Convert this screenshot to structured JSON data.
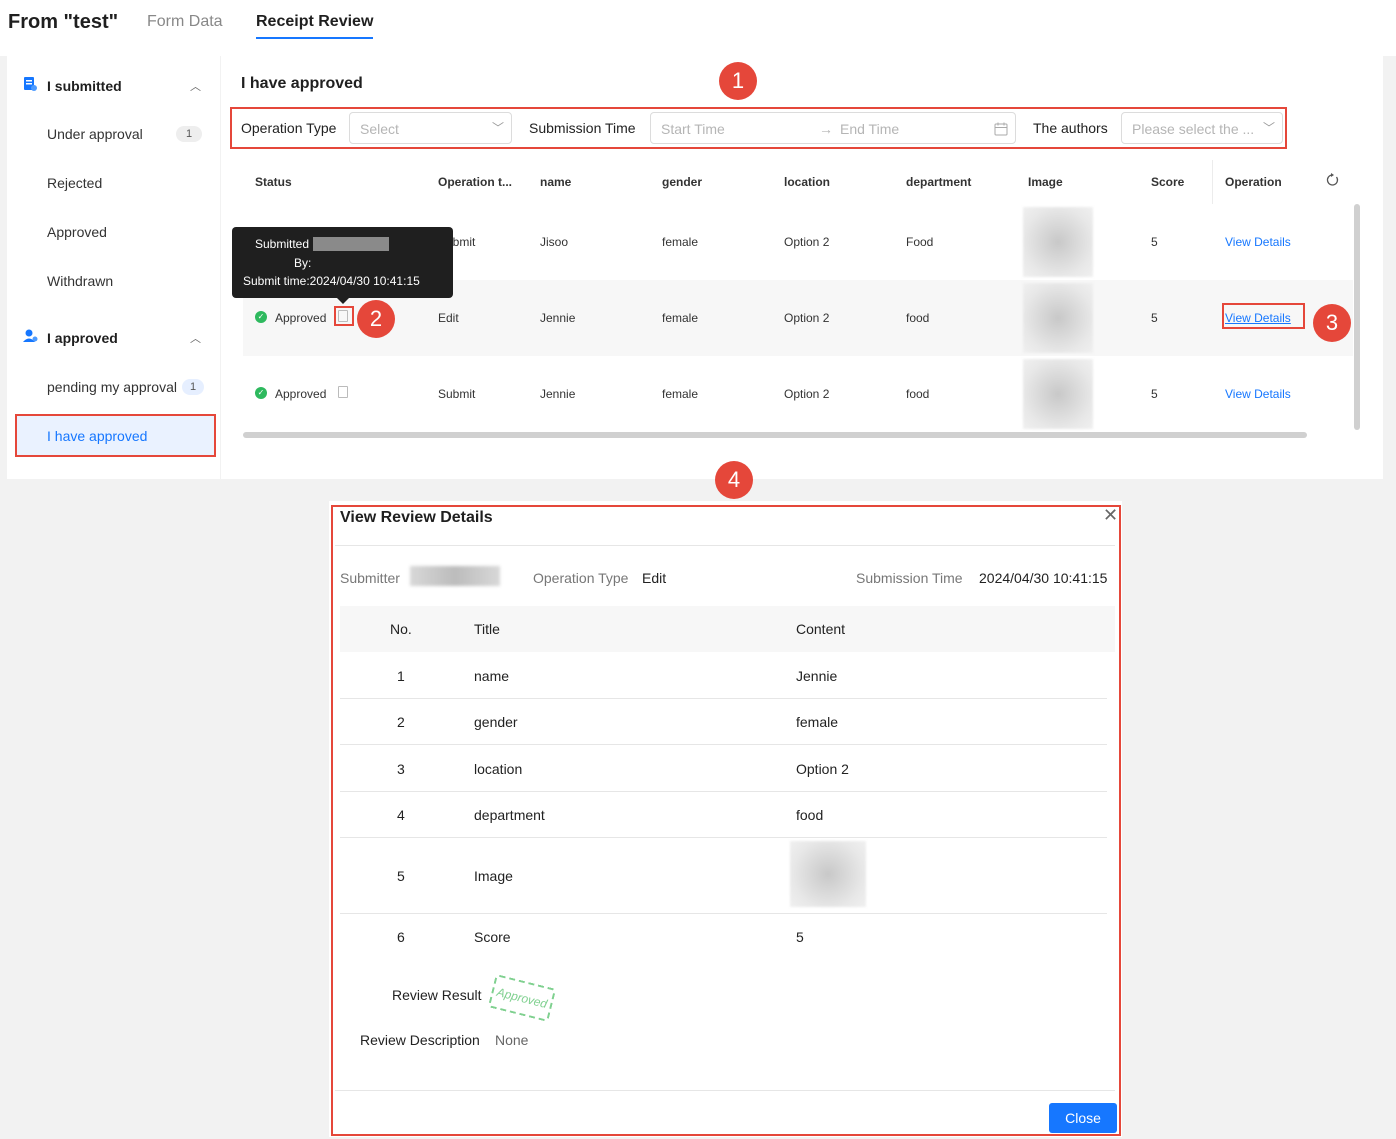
{
  "header": {
    "app_title": "From \"test\"",
    "tabs": [
      "Form Data",
      "Receipt Review"
    ]
  },
  "sidebar": {
    "group1": {
      "label": "I submitted",
      "items": [
        {
          "label": "Under approval",
          "badge": "1"
        },
        {
          "label": "Rejected"
        },
        {
          "label": "Approved"
        },
        {
          "label": "Withdrawn"
        }
      ]
    },
    "group2": {
      "label": "I approved",
      "items": [
        {
          "label": "pending my approval",
          "badge": "1"
        },
        {
          "label": "I have approved"
        }
      ]
    }
  },
  "annotations": {
    "c1": "1",
    "c2": "2",
    "c3": "3",
    "c4": "4"
  },
  "main": {
    "title": "I have approved",
    "filters": {
      "op_type_label": "Operation Type",
      "op_type_placeholder": "Select",
      "sub_time_label": "Submission Time",
      "start_placeholder": "Start Time",
      "arrow": "→",
      "end_placeholder": "End Time",
      "authors_label": "The authors",
      "authors_placeholder": "Please select the ..."
    },
    "columns": [
      "Status",
      "Operation t...",
      "name",
      "gender",
      "location",
      "department",
      "Image",
      "Score",
      "Operation"
    ],
    "rows": [
      {
        "status": "",
        "op": "Submit",
        "name": "Jisoo",
        "gender": "female",
        "location": "Option 2",
        "department": "Food",
        "score": "5",
        "action": "View Details"
      },
      {
        "status": "Approved",
        "op": "Edit",
        "name": "Jennie",
        "gender": "female",
        "location": "Option 2",
        "department": "food",
        "score": "5",
        "action": "View Details"
      },
      {
        "status": "Approved",
        "op": "Submit",
        "name": "Jennie",
        "gender": "female",
        "location": "Option 2",
        "department": "food",
        "score": "5",
        "action": "View Details"
      }
    ],
    "tooltip": {
      "line1": "Submitted",
      "line2": "By:",
      "line3": "Submit time:2024/04/30 10:41:15"
    }
  },
  "modal": {
    "title": "View Review Details",
    "submitter_label": "Submitter",
    "op_type_label": "Operation Type",
    "op_type_value": "Edit",
    "sub_time_label": "Submission Time",
    "sub_time_value": "2024/04/30 10:41:15",
    "columns": [
      "No.",
      "Title",
      "Content"
    ],
    "rows": [
      {
        "no": "1",
        "title": "name",
        "content": "Jennie"
      },
      {
        "no": "2",
        "title": "gender",
        "content": "female"
      },
      {
        "no": "3",
        "title": "location",
        "content": "Option 2"
      },
      {
        "no": "4",
        "title": "department",
        "content": "food"
      },
      {
        "no": "5",
        "title": "Image",
        "content": ""
      },
      {
        "no": "6",
        "title": "Score",
        "content": "5"
      }
    ],
    "review_result_label": "Review Result",
    "stamp": "Approved",
    "review_desc_label": "Review Description",
    "review_desc_value": "None",
    "close_label": "Close"
  },
  "colors": {
    "accent": "#1677ff",
    "annotation": "#e5473a",
    "success": "#2eb95e"
  }
}
